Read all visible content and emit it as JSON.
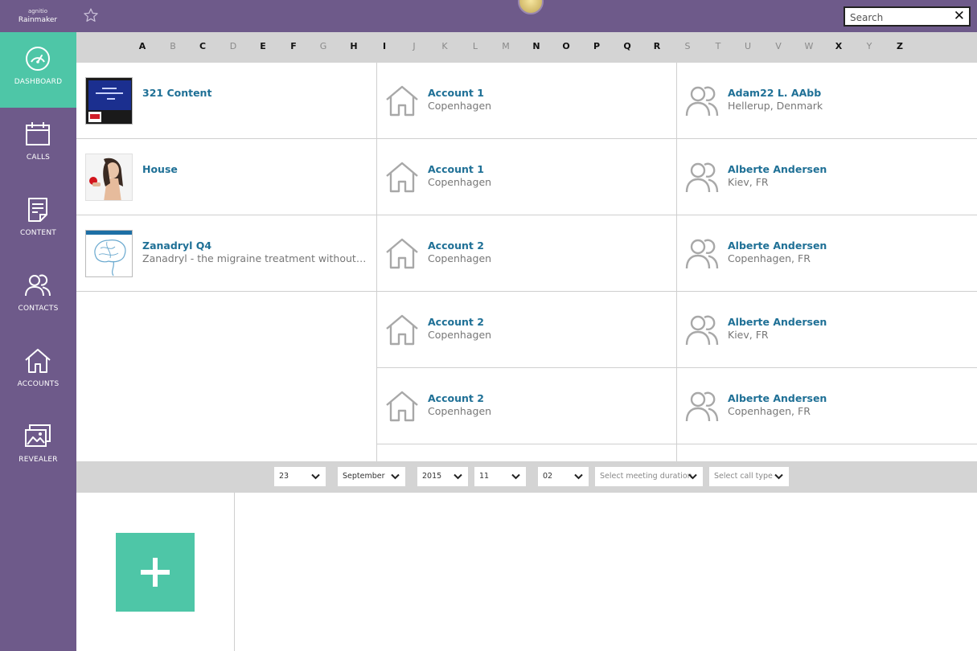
{
  "header": {
    "brand_small": "agnitio",
    "brand_name": "Rainmaker",
    "favorite_icon": "star-icon",
    "search_placeholder": "Search",
    "clear_label": "✕"
  },
  "sidebar": {
    "items": [
      {
        "label": "DASHBOARD",
        "icon": "dashboard-icon",
        "active": true
      },
      {
        "label": "CALLS",
        "icon": "calendar-icon",
        "active": false
      },
      {
        "label": "CONTENT",
        "icon": "document-icon",
        "active": false
      },
      {
        "label": "CONTACTS",
        "icon": "people-icon",
        "active": false
      },
      {
        "label": "ACCOUNTS",
        "icon": "house-icon",
        "active": false
      },
      {
        "label": "REVEALER",
        "icon": "images-icon",
        "active": false
      }
    ]
  },
  "alphabet": [
    {
      "letter": "A",
      "enabled": true
    },
    {
      "letter": "B",
      "enabled": false
    },
    {
      "letter": "C",
      "enabled": true
    },
    {
      "letter": "D",
      "enabled": false
    },
    {
      "letter": "E",
      "enabled": true
    },
    {
      "letter": "F",
      "enabled": true
    },
    {
      "letter": "G",
      "enabled": false
    },
    {
      "letter": "H",
      "enabled": true
    },
    {
      "letter": "I",
      "enabled": true
    },
    {
      "letter": "J",
      "enabled": false
    },
    {
      "letter": "K",
      "enabled": false
    },
    {
      "letter": "L",
      "enabled": false
    },
    {
      "letter": "M",
      "enabled": false
    },
    {
      "letter": "N",
      "enabled": true
    },
    {
      "letter": "O",
      "enabled": true
    },
    {
      "letter": "P",
      "enabled": true
    },
    {
      "letter": "Q",
      "enabled": true
    },
    {
      "letter": "R",
      "enabled": true
    },
    {
      "letter": "S",
      "enabled": false
    },
    {
      "letter": "T",
      "enabled": false
    },
    {
      "letter": "U",
      "enabled": false
    },
    {
      "letter": "V",
      "enabled": false
    },
    {
      "letter": "W",
      "enabled": false
    },
    {
      "letter": "X",
      "enabled": true
    },
    {
      "letter": "Y",
      "enabled": false
    },
    {
      "letter": "Z",
      "enabled": true
    }
  ],
  "content_items": [
    {
      "title": "321 Content",
      "subtitle": ""
    },
    {
      "title": "House",
      "subtitle": ""
    },
    {
      "title": "Zanadryl Q4",
      "subtitle": "Zanadryl - the migraine treatment without any..."
    }
  ],
  "accounts": [
    {
      "name": "Account 1",
      "city": "Copenhagen"
    },
    {
      "name": "Account 1",
      "city": "Copenhagen"
    },
    {
      "name": "Account 2",
      "city": "Copenhagen"
    },
    {
      "name": "Account 2",
      "city": "Copenhagen"
    },
    {
      "name": "Account 2",
      "city": "Copenhagen"
    }
  ],
  "contacts": [
    {
      "name": "Adam22 L. AAbb",
      "location": "Hellerup, Denmark"
    },
    {
      "name": "Alberte Andersen",
      "location": "Kiev, FR"
    },
    {
      "name": "Alberte Andersen",
      "location": "Copenhagen, FR"
    },
    {
      "name": "Alberte Andersen",
      "location": "Kiev, FR"
    },
    {
      "name": "Alberte Andersen",
      "location": "Copenhagen, FR"
    }
  ],
  "datebar": {
    "day": "23",
    "month": "September",
    "year": "2015",
    "hour": "11",
    "minute": "02",
    "duration_placeholder": "Select meeting duration",
    "call_type_placeholder": "Select call type"
  },
  "actions": {
    "add_icon": "plus-icon"
  },
  "colors": {
    "brand_purple": "#6e5a8a",
    "accent_green": "#4ec6a7",
    "link_blue": "#1f7096",
    "bar_gray": "#d4d4d4"
  }
}
